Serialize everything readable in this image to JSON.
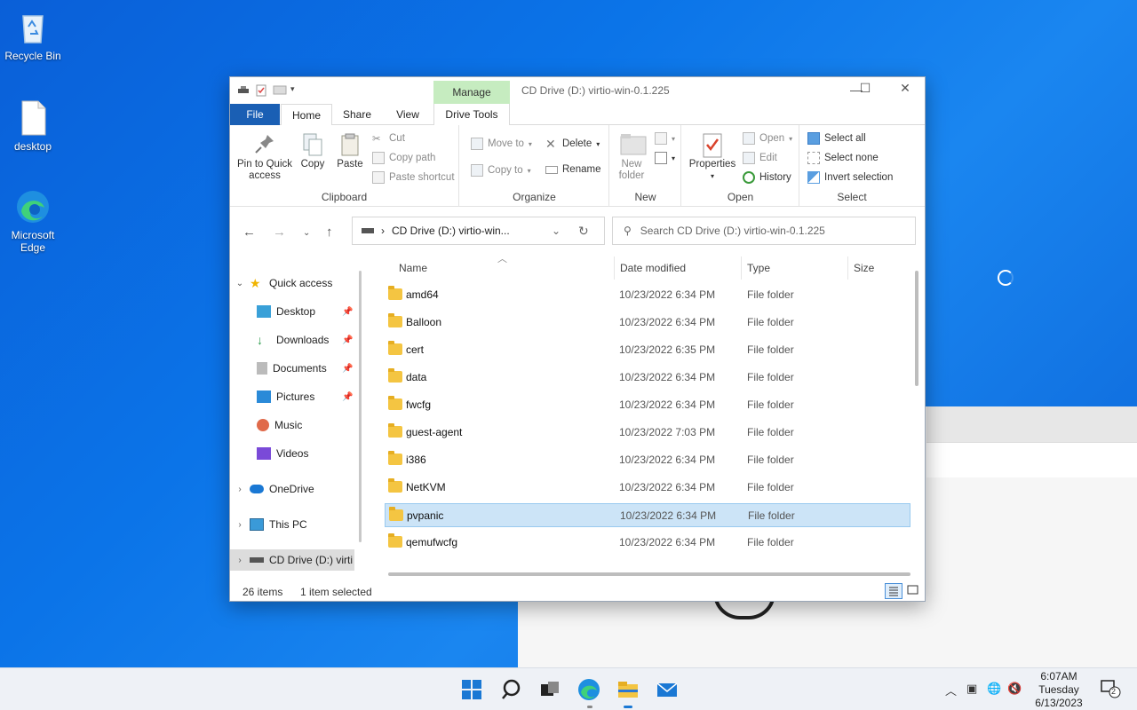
{
  "desktop": {
    "icons": [
      {
        "label": "Recycle Bin"
      },
      {
        "label": "desktop"
      },
      {
        "label": "Microsoft Edge"
      }
    ]
  },
  "window": {
    "title": "CD Drive (D:) virtio-win-0.1.225",
    "context_tab": "Manage",
    "tabs": [
      "File",
      "Home",
      "Share",
      "View",
      "Drive Tools"
    ],
    "help_label": "?"
  },
  "ribbon": {
    "clipboard": {
      "label": "Clipboard",
      "pin": "Pin to Quick access",
      "copy": "Copy",
      "paste": "Paste",
      "cut": "Cut",
      "copy_path": "Copy path",
      "paste_shortcut": "Paste shortcut"
    },
    "organize": {
      "label": "Organize",
      "move_to": "Move to",
      "copy_to": "Copy to",
      "delete": "Delete",
      "rename": "Rename"
    },
    "new": {
      "label": "New",
      "new_folder": "New folder"
    },
    "open": {
      "label": "Open",
      "properties": "Properties",
      "open": "Open",
      "edit": "Edit",
      "history": "History"
    },
    "select": {
      "label": "Select",
      "select_all": "Select all",
      "select_none": "Select none",
      "invert": "Invert selection"
    }
  },
  "address": {
    "path": "CD Drive (D:) virtio-win...",
    "search_placeholder": "Search CD Drive (D:) virtio-win-0.1.225"
  },
  "navpane": {
    "quick_access": "Quick access",
    "items": [
      "Desktop",
      "Downloads",
      "Documents",
      "Pictures",
      "Music",
      "Videos"
    ],
    "onedrive": "OneDrive",
    "this_pc": "This PC",
    "cd_drive": "CD Drive (D:) virti"
  },
  "columns": {
    "name": "Name",
    "date": "Date modified",
    "type": "Type",
    "size": "Size"
  },
  "files": [
    {
      "name": "amd64",
      "date": "10/23/2022 6:34 PM",
      "type": "File folder"
    },
    {
      "name": "Balloon",
      "date": "10/23/2022 6:34 PM",
      "type": "File folder"
    },
    {
      "name": "cert",
      "date": "10/23/2022 6:35 PM",
      "type": "File folder"
    },
    {
      "name": "data",
      "date": "10/23/2022 6:34 PM",
      "type": "File folder"
    },
    {
      "name": "fwcfg",
      "date": "10/23/2022 6:34 PM",
      "type": "File folder"
    },
    {
      "name": "guest-agent",
      "date": "10/23/2022 7:03 PM",
      "type": "File folder"
    },
    {
      "name": "i386",
      "date": "10/23/2022 6:34 PM",
      "type": "File folder"
    },
    {
      "name": "NetKVM",
      "date": "10/23/2022 6:34 PM",
      "type": "File folder"
    },
    {
      "name": "pvpanic",
      "date": "10/23/2022 6:34 PM",
      "type": "File folder"
    },
    {
      "name": "qemufwcfg",
      "date": "10/23/2022 6:34 PM",
      "type": "File folder"
    }
  ],
  "status": {
    "count": "26 items",
    "selected": "1 item selected"
  },
  "clock": {
    "time": "6:07AM",
    "day": "Tuesday",
    "date": "6/13/2023"
  },
  "notifications": {
    "count": "2"
  },
  "colors": {
    "accent": "#1a5fb4",
    "manage_tab": "#c6ecc0",
    "selection": "#cce4f7",
    "folder": "#f4c542"
  }
}
